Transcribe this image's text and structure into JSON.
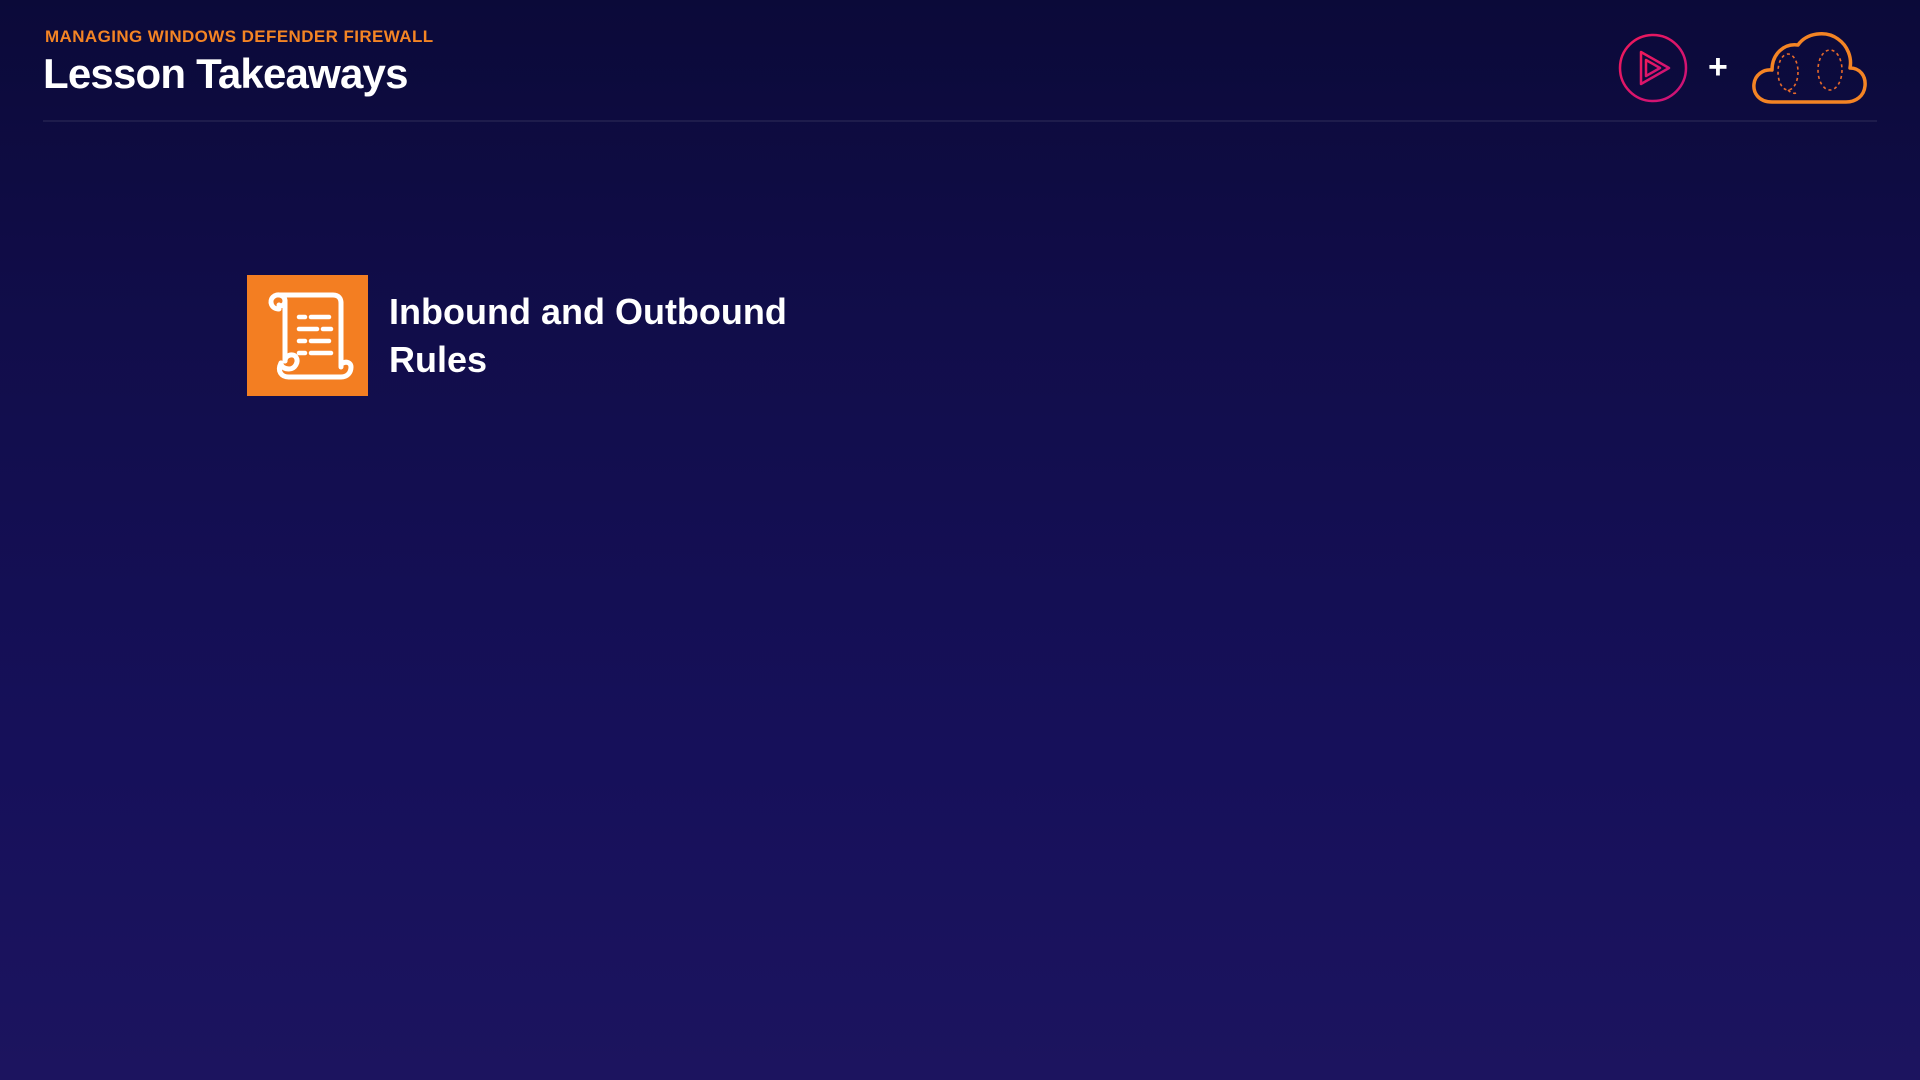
{
  "header": {
    "course_title": "MANAGING WINDOWS DEFENDER FIREWALL",
    "lesson_title": "Lesson Takeaways",
    "logos": {
      "play_logo_icon": "play-circle-icon",
      "plus_text": "+",
      "cloud_logo_icon": "cloud-brain-icon"
    }
  },
  "takeaways": [
    {
      "icon": "scroll-document-icon",
      "label": "Inbound and Outbound Rules"
    }
  ],
  "colors": {
    "background_top": "#0b0a39",
    "background_bottom": "#1c145f",
    "accent_orange": "#f37e22",
    "play_logo_gradient_start": "#e8125f",
    "play_logo_gradient_end": "#d4126c"
  }
}
